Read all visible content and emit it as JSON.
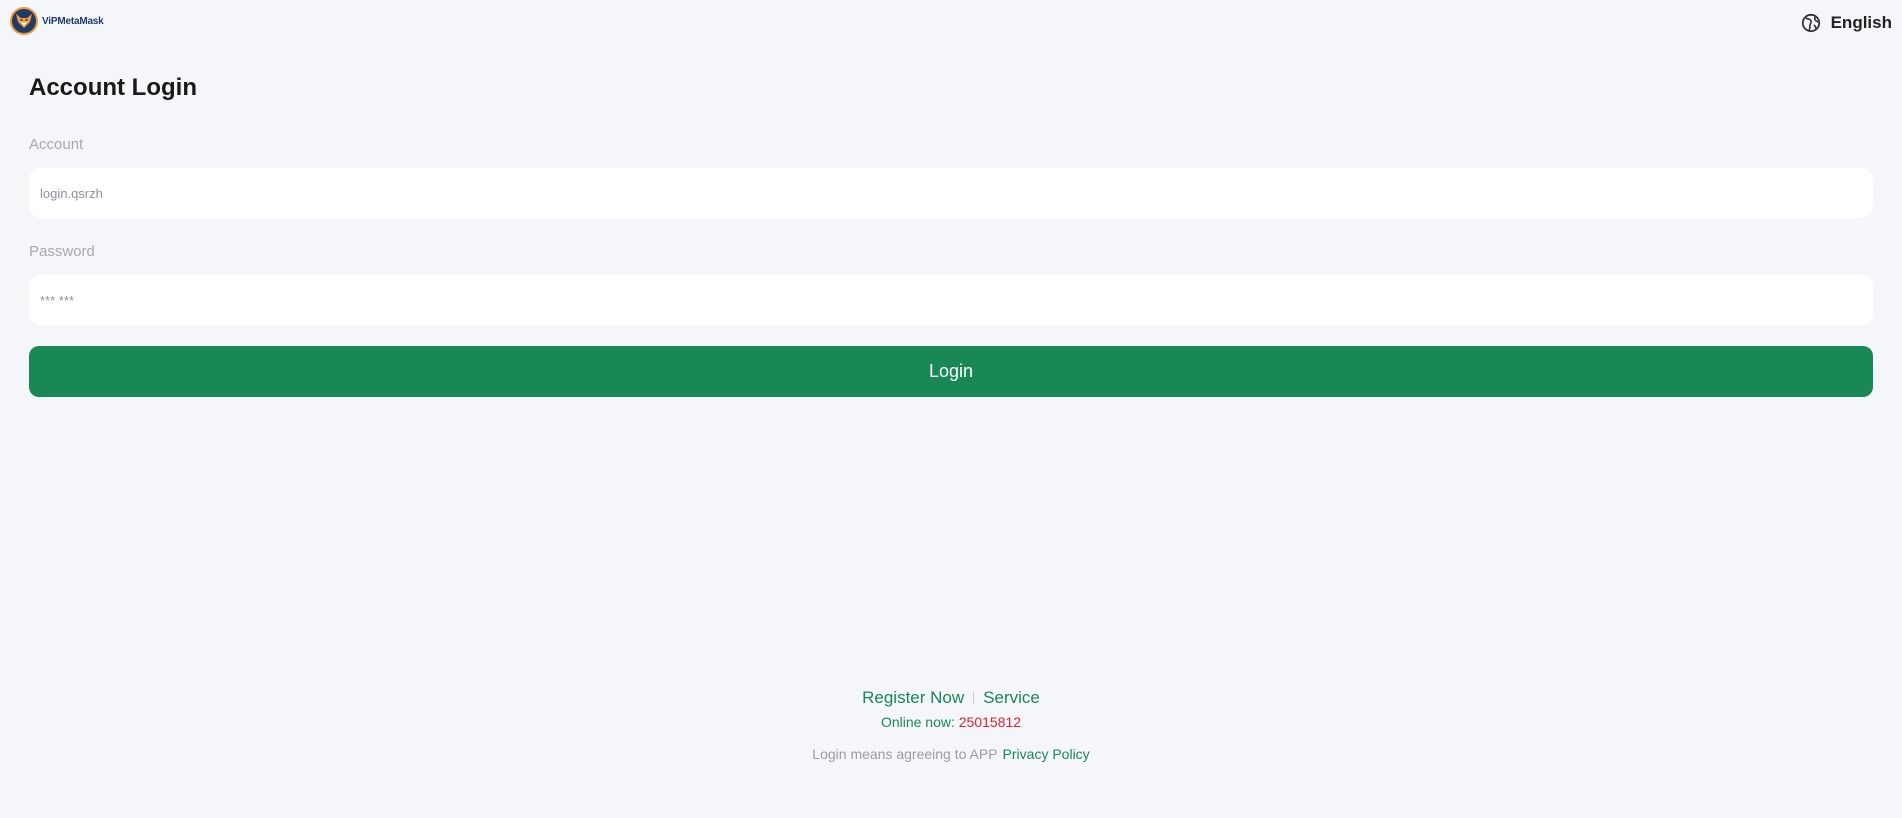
{
  "header": {
    "brand_name": "ViPMetaMask",
    "logo_icon": "fox-logo-icon",
    "language_icon": "globe-icon",
    "language_label": "English"
  },
  "login": {
    "title": "Account Login",
    "account_label": "Account",
    "account_placeholder": "login.qsrzh",
    "password_label": "Password",
    "password_placeholder": "*** ***",
    "submit_label": "Login"
  },
  "footer": {
    "register_label": "Register Now",
    "service_label": "Service",
    "online_label": "Online now:",
    "online_count": "25015812",
    "agree_text": "Login means agreeing to APP",
    "privacy_label": "Privacy Policy"
  },
  "colors": {
    "background": "#f4f6fa",
    "primary": "#1a8856",
    "count_red": "#e0202a",
    "muted": "#a6a9b0"
  }
}
